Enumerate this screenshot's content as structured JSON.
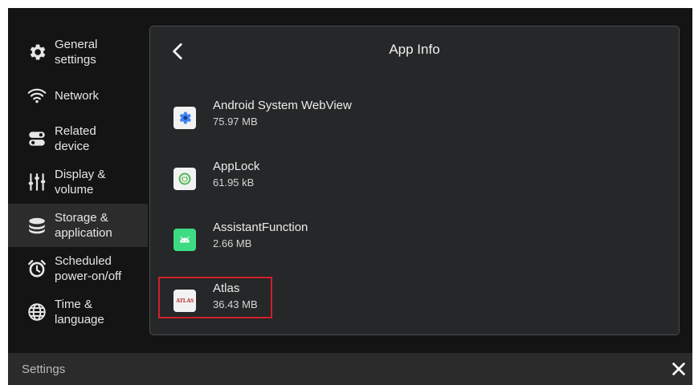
{
  "sidebar": {
    "items": [
      {
        "label": "General\nsettings",
        "icon": "gear-icon"
      },
      {
        "label": "Network",
        "icon": "wifi-icon"
      },
      {
        "label": "Related\ndevice",
        "icon": "toggle-switches-icon"
      },
      {
        "label": "Display &\nvolume",
        "icon": "sliders-icon"
      },
      {
        "label": "Storage &\napplication",
        "icon": "storage-stack-icon"
      },
      {
        "label": "Scheduled\npower-on/off",
        "icon": "alarm-clock-icon"
      },
      {
        "label": "Time &\nlanguage",
        "icon": "globe-icon"
      }
    ],
    "active_index": 4
  },
  "panel": {
    "title": "App Info",
    "apps": [
      {
        "name": "Android System WebView",
        "size": "75.97 MB",
        "icon": "webview-gear-icon"
      },
      {
        "name": "AppLock",
        "size": "61.95 kB",
        "icon": "applock-icon"
      },
      {
        "name": "AssistantFunction",
        "size": "2.66 MB",
        "icon": "android-icon"
      },
      {
        "name": "Atlas",
        "size": "36.43 MB",
        "icon": "atlas-logo-icon",
        "logo_text": "ATLAS",
        "highlighted": true
      }
    ]
  },
  "bottom_bar": {
    "title": "Settings"
  },
  "colors": {
    "background": "#141414",
    "panel": "#262728",
    "active_item": "#2c2c2c",
    "highlight": "#d0202a",
    "android_green": "#3ddc84"
  }
}
